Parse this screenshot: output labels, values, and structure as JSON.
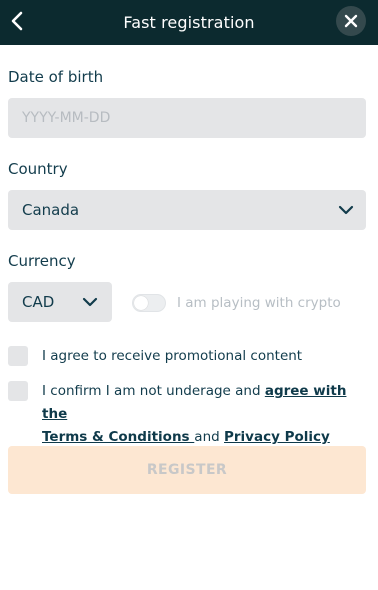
{
  "header": {
    "title": "Fast registration",
    "back_icon": "chevron-left-icon",
    "close_icon": "close-icon"
  },
  "form": {
    "dob": {
      "label": "Date of birth",
      "placeholder": "YYYY-MM-DD",
      "value": ""
    },
    "country": {
      "label": "Country",
      "value": "Canada"
    },
    "currency": {
      "label": "Currency",
      "value": "CAD"
    },
    "crypto_toggle": {
      "label": "I am playing with crypto",
      "enabled": false
    },
    "promo_consent": {
      "label": "I agree to receive promotional content",
      "checked": false
    },
    "terms_consent": {
      "text_before": "I confirm I am not underage and ",
      "link_agree": "agree with the",
      "link_terms": "Terms & Conditions ",
      "text_and": "and ",
      "link_privacy": "Privacy Policy",
      "checked": false
    }
  },
  "register_button": {
    "label": "REGISTER",
    "disabled": true
  },
  "colors": {
    "header_bg": "#0c2a2f",
    "text": "#123c4c",
    "field_bg": "#e4e5e7",
    "register_bg_disabled": "#fde7d2"
  }
}
